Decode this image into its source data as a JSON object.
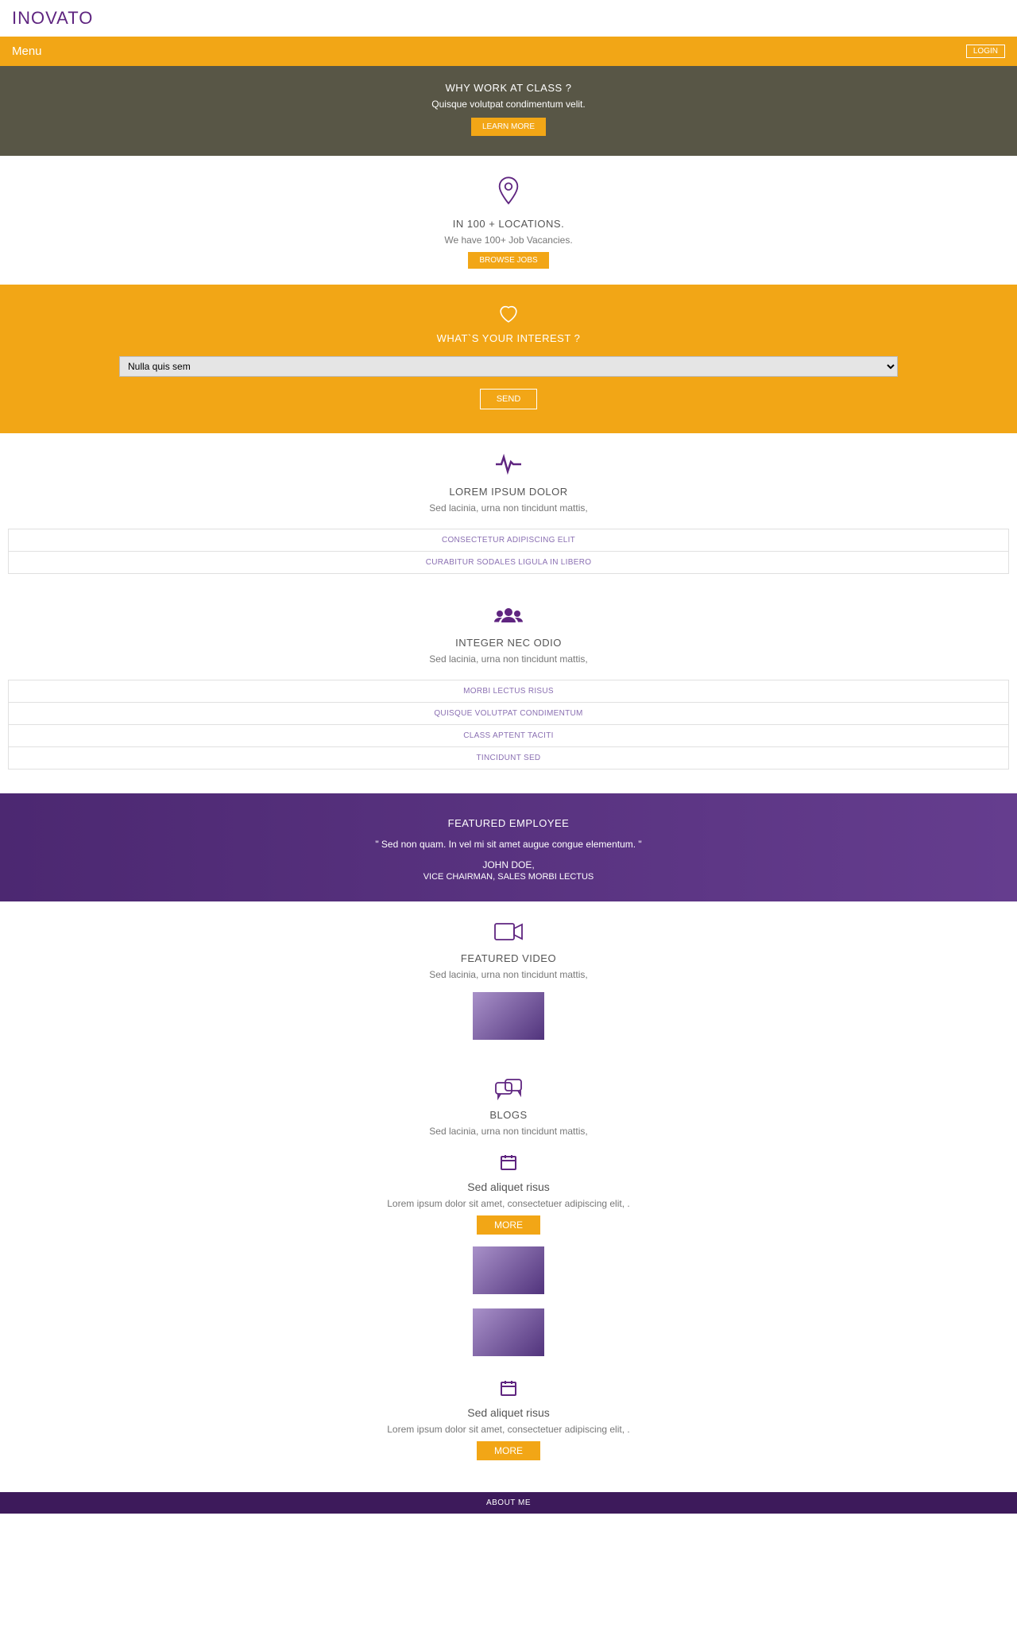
{
  "brand": "INOVATO",
  "nav": {
    "menu": "Menu",
    "login": "LOGIN"
  },
  "hero": {
    "title": "WHY WORK AT CLASS ?",
    "subtitle": "Quisque volutpat condimentum velit.",
    "button": "LEARN MORE"
  },
  "locations": {
    "title": "IN 100 + LOCATIONS.",
    "subtitle": "We have 100+ Job Vacancies.",
    "button": "BROWSE JOBS"
  },
  "interest": {
    "title": "WHAT`S YOUR INTEREST ?",
    "selected": "Nulla quis sem",
    "button": "SEND"
  },
  "lorem1": {
    "title": "LOREM IPSUM DOLOR",
    "subtitle": "Sed lacinia, urna non tincidunt mattis,",
    "items": [
      "CONSECTETUR ADIPISCING ELIT",
      "CURABITUR SODALES LIGULA IN LIBERO"
    ]
  },
  "lorem2": {
    "title": "INTEGER NEC ODIO",
    "subtitle": "Sed lacinia, urna non tincidunt mattis,",
    "items": [
      "MORBI LECTUS RISUS",
      "QUISQUE VOLUTPAT CONDIMENTUM",
      "CLASS APTENT TACITI",
      "TINCIDUNT SED"
    ]
  },
  "featured": {
    "heading": "FEATURED EMPLOYEE",
    "quote": "\" Sed non quam. In vel mi sit amet augue congue elementum. \"",
    "name": "JOHN DOE,",
    "title": "VICE CHAIRMAN, SALES MORBI LECTUS"
  },
  "video": {
    "heading": "FEATURED VIDEO",
    "subtitle": "Sed lacinia, urna non tincidunt mattis,"
  },
  "blogs": {
    "heading": "BLOGS",
    "subtitle": "Sed lacinia, urna non tincidunt mattis,",
    "posts": [
      {
        "title": "Sed aliquet risus",
        "desc": "Lorem ipsum dolor sit amet, consectetuer adipiscing elit, .",
        "button": "MORE"
      },
      {
        "title": "Sed aliquet risus",
        "desc": "Lorem ipsum dolor sit amet, consectetuer adipiscing elit, .",
        "button": "MORE"
      }
    ]
  },
  "footer": {
    "about": "ABOUT ME"
  }
}
